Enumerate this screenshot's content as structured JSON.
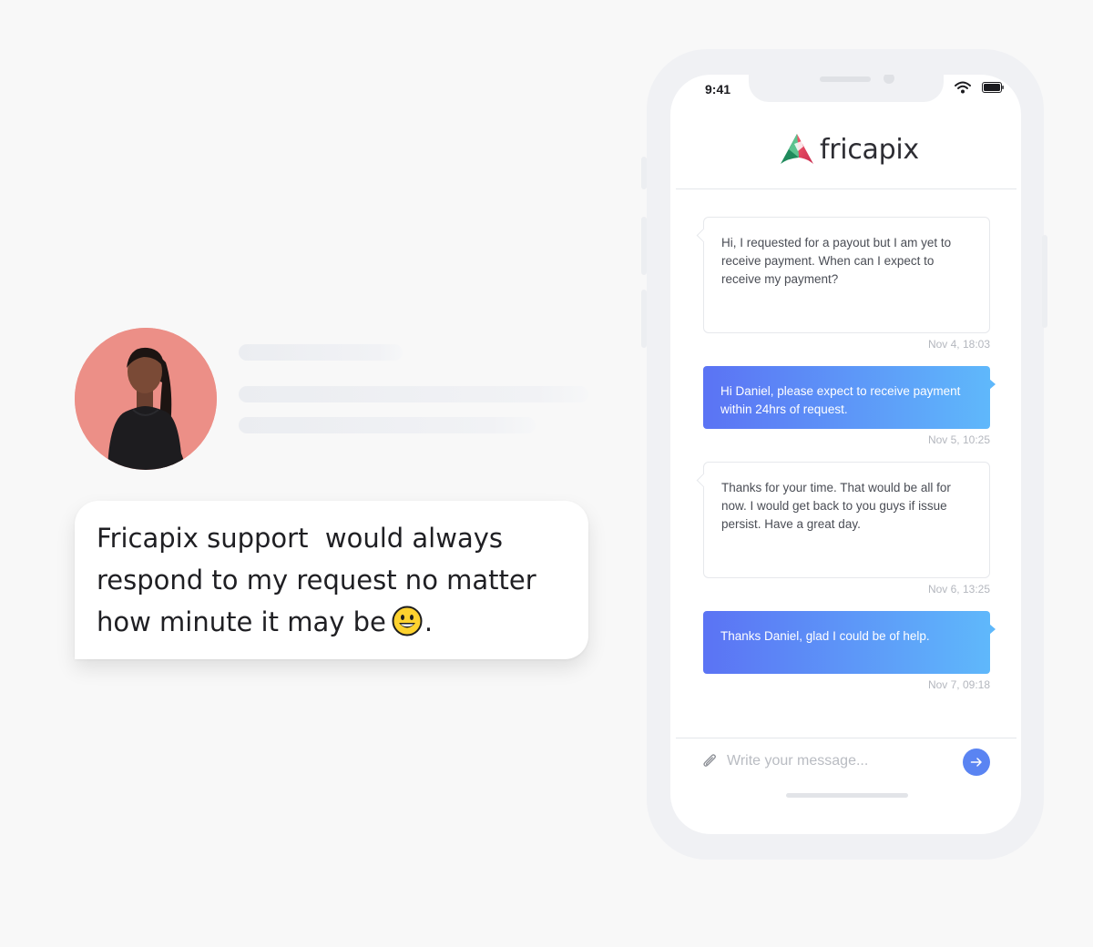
{
  "testimonial": {
    "quote_main": "Fricapix support  would always respond to my request no matter how minute it may be",
    "quote_end": ".",
    "emoji_icon": "grinning-face-emoji",
    "avatar_background": "#ec8f87"
  },
  "phone": {
    "status": {
      "time": "9:41",
      "wifi_icon": "wifi-icon",
      "battery_icon": "battery-icon"
    },
    "brand": {
      "name": "fricapix",
      "logo_icon": "fricapix-logo-icon"
    },
    "messages": [
      {
        "direction": "incoming",
        "text": "Hi, I requested for a payout but I am yet to receive payment. When can I expect to receive my payment?",
        "time": "Nov 4, 18:03"
      },
      {
        "direction": "outgoing",
        "text": "Hi Daniel, please expect to receive payment within 24hrs of request.",
        "time": "Nov 5, 10:25"
      },
      {
        "direction": "incoming",
        "text": "Thanks for your time. That would be all for now. I would get back to you guys if issue persist. Have a great day.",
        "time": "Nov 6, 13:25"
      },
      {
        "direction": "outgoing",
        "text": "Thanks Daniel, glad I could be of help.",
        "time": "Nov 7, 09:18"
      }
    ],
    "composer": {
      "placeholder": "Write your message...",
      "value": "",
      "attach_icon": "paperclip-icon",
      "send_icon": "arrow-right-icon"
    }
  },
  "colors": {
    "accent_blue": "#5a84f2",
    "gradient_start": "#5b73f4",
    "gradient_end": "#5fb8fb",
    "background": "#f8f8f8"
  }
}
